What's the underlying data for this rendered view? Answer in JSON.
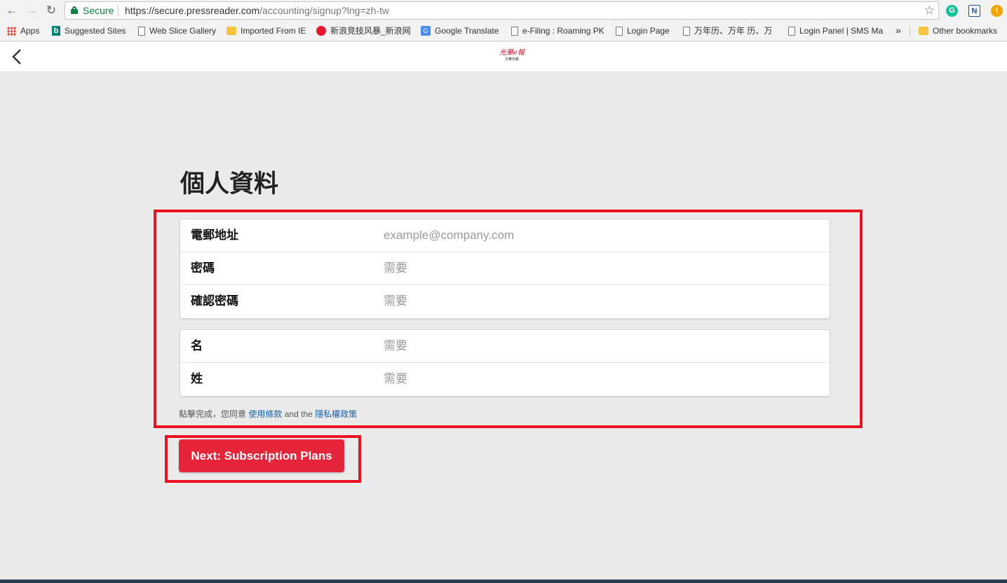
{
  "browser": {
    "secure_label": "Secure",
    "url_host": "https://secure.pressreader.com",
    "url_path": "/accounting/signup?lng=zh-tw",
    "bookmarks": [
      {
        "label": "Apps",
        "icon": "apps-grid-icon"
      },
      {
        "label": "Suggested Sites",
        "icon": "bing-icon"
      },
      {
        "label": "Web Slice Gallery",
        "icon": "page-icon"
      },
      {
        "label": "Imported From IE",
        "icon": "folder-icon"
      },
      {
        "label": "新浪竞技风暴_新浪网",
        "icon": "weibo-icon"
      },
      {
        "label": "Google Translate",
        "icon": "google-translate-icon"
      },
      {
        "label": "e-Filing : Roaming PK",
        "icon": "page-icon"
      },
      {
        "label": "Login Page",
        "icon": "page-icon"
      },
      {
        "label": "万年历、万年 历、万",
        "icon": "page-icon"
      },
      {
        "label": "Login Panel | SMS Ma",
        "icon": "page-icon"
      }
    ],
    "more_label": "»",
    "other_bookmarks": "Other bookmarks",
    "extensions": [
      {
        "name": "grammarly-icon",
        "glyph": "G",
        "color": "#15c39a"
      },
      {
        "name": "n-extension-icon",
        "glyph": "N",
        "color": "#1a4fa0"
      },
      {
        "name": "alert-extension-icon",
        "glyph": "!",
        "color": "#f4a300"
      }
    ]
  },
  "header": {
    "logo_main": "光華e報",
    "logo_sub": "光華日報"
  },
  "page": {
    "title": "個人資料",
    "account_fields": [
      {
        "label": "電郵地址",
        "placeholder": "example@company.com",
        "type": "email"
      },
      {
        "label": "密碼",
        "placeholder": "需要",
        "type": "password"
      },
      {
        "label": "確認密碼",
        "placeholder": "需要",
        "type": "password"
      }
    ],
    "name_fields": [
      {
        "label": "名",
        "placeholder": "需要"
      },
      {
        "label": "姓",
        "placeholder": "需要"
      }
    ],
    "terms_prefix": "點擊完成，您同意",
    "terms_link": "使用條款",
    "terms_mid": "and the",
    "privacy_link": "隱私權政策",
    "next_button": "Next: Subscription Plans"
  },
  "colors": {
    "accent": "#e4253a",
    "annotation": "#e8131f",
    "link": "#1a5fa5",
    "secure": "#0b8043"
  }
}
